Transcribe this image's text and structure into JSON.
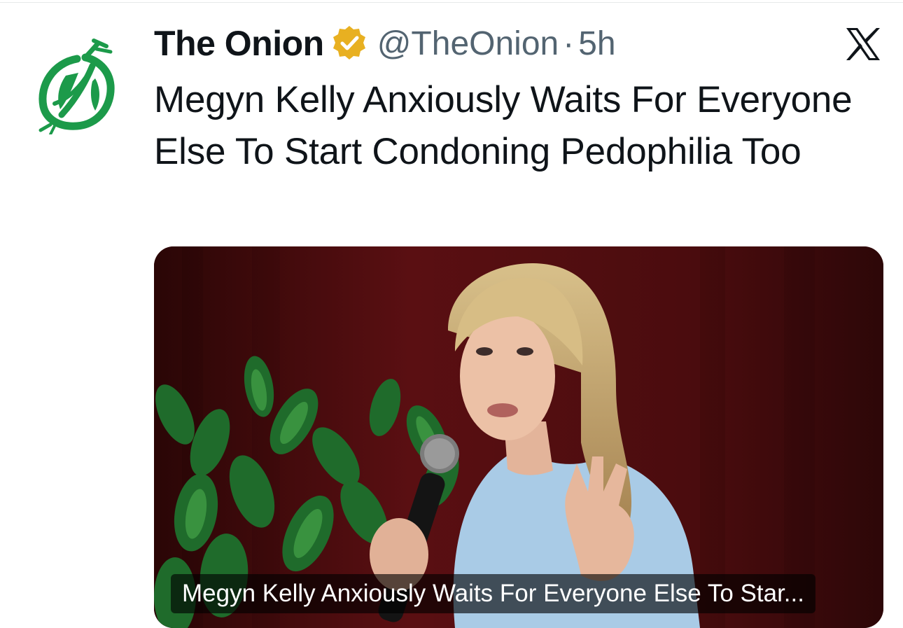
{
  "tweet": {
    "author_name": "The Onion",
    "handle": "@TheOnion",
    "separator": "·",
    "time": "5h",
    "text": "Megyn Kelly Anxiously Waits For Everyone Else To Start Condoning Pedophilia Too",
    "verified_badge_icon": "verified-gold-badge-icon",
    "avatar_icon": "onion-logo-icon",
    "brand_icon": "x-logo-icon"
  },
  "media": {
    "caption": "Megyn Kelly Anxiously Waits For Everyone Else To Star...",
    "image_subject": "woman-speaking-into-microphone-photo"
  },
  "colors": {
    "onion_green": "#1c9a4a",
    "verified_gold": "#e8b021",
    "text_primary": "#0f1419",
    "text_secondary": "#536471",
    "backdrop_red": "#5a0f12"
  }
}
